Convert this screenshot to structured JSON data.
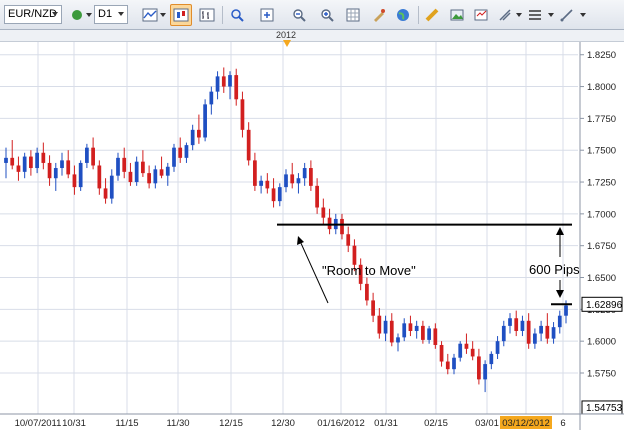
{
  "toolbar": {
    "symbol": "EUR/NZD",
    "timeframe": "D1",
    "icons": [
      "circle-indicator-icon",
      "line-chart-icon",
      "candlestick-chart-icon",
      "bar-chart-icon",
      "crosshair-icon",
      "zoom-in-icon",
      "zoom-out-icon",
      "zoom-fit-icon",
      "grid-icon",
      "color-scheme-icon",
      "globe-icon",
      "ruler-icon",
      "screenshot-icon",
      "print-icon",
      "indicators-icon",
      "settings-icon",
      "drawing-tool-icon"
    ]
  },
  "timebar": {
    "year_label": "2012"
  },
  "colors": {
    "bull": "#1f4fc2",
    "bear": "#d21f1f",
    "grid": "#d8dde8",
    "axis_bg": "#ffffff",
    "current_bg": "#ffffff",
    "date_highlight": "#f5a81e",
    "low_bg": "#ffffff"
  },
  "annotations": {
    "room_to_move": "\"Room to Move\"",
    "pips": "600 Pips"
  },
  "chart_data": {
    "type": "candlestick",
    "instrument": "EUR/NZD",
    "timeframe": "D1",
    "y_axis": {
      "ticks": [
        "1.8250",
        "1.8000",
        "1.7750",
        "1.7500",
        "1.7250",
        "1.7000",
        "1.6750",
        "1.6500",
        "1.6250",
        "1.6000",
        "1.5750"
      ],
      "range": [
        1.5475,
        1.835
      ],
      "current_price": "1.62896",
      "low_price": "1.54753"
    },
    "x_axis": {
      "labels": [
        "10/07/2011",
        "10/31",
        "11/15",
        "11/30",
        "12/15",
        "12/30",
        "01/16/2012",
        "01/31",
        "02/15",
        "03/01",
        "03/12/2012",
        "6"
      ],
      "highlighted_label": "03/12/2012"
    },
    "resistance_level": 1.6915,
    "current_level": 1.62896,
    "grid": true,
    "candles": [
      [
        1.74,
        1.752,
        1.728,
        1.744
      ],
      [
        1.744,
        1.758,
        1.735,
        1.738
      ],
      [
        1.738,
        1.745,
        1.726,
        1.733
      ],
      [
        1.733,
        1.748,
        1.728,
        1.745
      ],
      [
        1.745,
        1.75,
        1.73,
        1.736
      ],
      [
        1.736,
        1.752,
        1.732,
        1.748
      ],
      [
        1.748,
        1.756,
        1.735,
        1.74
      ],
      [
        1.74,
        1.746,
        1.722,
        1.728
      ],
      [
        1.728,
        1.74,
        1.718,
        1.736
      ],
      [
        1.736,
        1.748,
        1.73,
        1.742
      ],
      [
        1.742,
        1.75,
        1.728,
        1.731
      ],
      [
        1.731,
        1.738,
        1.715,
        1.721
      ],
      [
        1.721,
        1.742,
        1.718,
        1.74
      ],
      [
        1.74,
        1.755,
        1.736,
        1.752
      ],
      [
        1.752,
        1.76,
        1.735,
        1.738
      ],
      [
        1.738,
        1.742,
        1.715,
        1.72
      ],
      [
        1.72,
        1.728,
        1.708,
        1.712
      ],
      [
        1.712,
        1.735,
        1.708,
        1.73
      ],
      [
        1.73,
        1.748,
        1.726,
        1.744
      ],
      [
        1.744,
        1.752,
        1.728,
        1.733
      ],
      [
        1.733,
        1.74,
        1.722,
        1.725
      ],
      [
        1.725,
        1.745,
        1.722,
        1.741
      ],
      [
        1.741,
        1.75,
        1.729,
        1.732
      ],
      [
        1.732,
        1.738,
        1.72,
        1.724
      ],
      [
        1.724,
        1.738,
        1.72,
        1.735
      ],
      [
        1.735,
        1.745,
        1.728,
        1.73
      ],
      [
        1.73,
        1.74,
        1.722,
        1.737
      ],
      [
        1.737,
        1.755,
        1.733,
        1.752
      ],
      [
        1.752,
        1.76,
        1.74,
        1.744
      ],
      [
        1.744,
        1.756,
        1.74,
        1.754
      ],
      [
        1.754,
        1.77,
        1.75,
        1.766
      ],
      [
        1.766,
        1.778,
        1.755,
        1.76
      ],
      [
        1.76,
        1.79,
        1.757,
        1.786
      ],
      [
        1.786,
        1.8,
        1.778,
        1.796
      ],
      [
        1.796,
        1.812,
        1.79,
        1.808
      ],
      [
        1.808,
        1.815,
        1.795,
        1.8
      ],
      [
        1.8,
        1.812,
        1.79,
        1.809
      ],
      [
        1.809,
        1.814,
        1.785,
        1.79
      ],
      [
        1.79,
        1.796,
        1.76,
        1.766
      ],
      [
        1.766,
        1.772,
        1.738,
        1.742
      ],
      [
        1.742,
        1.748,
        1.718,
        1.722
      ],
      [
        1.722,
        1.73,
        1.716,
        1.726
      ],
      [
        1.726,
        1.732,
        1.716,
        1.72
      ],
      [
        1.72,
        1.728,
        1.705,
        1.71
      ],
      [
        1.71,
        1.724,
        1.706,
        1.721
      ],
      [
        1.721,
        1.735,
        1.717,
        1.731
      ],
      [
        1.731,
        1.74,
        1.72,
        1.724
      ],
      [
        1.724,
        1.732,
        1.716,
        1.728
      ],
      [
        1.728,
        1.74,
        1.722,
        1.736
      ],
      [
        1.736,
        1.742,
        1.718,
        1.722
      ],
      [
        1.722,
        1.728,
        1.7,
        1.705
      ],
      [
        1.705,
        1.712,
        1.692,
        1.697
      ],
      [
        1.697,
        1.704,
        1.684,
        1.688
      ],
      [
        1.688,
        1.7,
        1.684,
        1.696
      ],
      [
        1.696,
        1.7,
        1.68,
        1.684
      ],
      [
        1.684,
        1.69,
        1.67,
        1.675
      ],
      [
        1.675,
        1.68,
        1.655,
        1.66
      ],
      [
        1.66,
        1.665,
        1.64,
        1.645
      ],
      [
        1.645,
        1.65,
        1.628,
        1.632
      ],
      [
        1.632,
        1.638,
        1.615,
        1.62
      ],
      [
        1.62,
        1.626,
        1.602,
        1.606
      ],
      [
        1.606,
        1.62,
        1.6,
        1.616
      ],
      [
        1.616,
        1.622,
        1.596,
        1.599
      ],
      [
        1.599,
        1.606,
        1.592,
        1.603
      ],
      [
        1.603,
        1.618,
        1.6,
        1.614
      ],
      [
        1.614,
        1.62,
        1.604,
        1.608
      ],
      [
        1.608,
        1.616,
        1.602,
        1.612
      ],
      [
        1.612,
        1.616,
        1.598,
        1.601
      ],
      [
        1.601,
        1.612,
        1.598,
        1.61
      ],
      [
        1.61,
        1.614,
        1.594,
        1.597
      ],
      [
        1.597,
        1.6,
        1.58,
        1.584
      ],
      [
        1.584,
        1.59,
        1.574,
        1.578
      ],
      [
        1.578,
        1.59,
        1.574,
        1.587
      ],
      [
        1.587,
        1.6,
        1.584,
        1.598
      ],
      [
        1.598,
        1.606,
        1.59,
        1.594
      ],
      [
        1.594,
        1.6,
        1.585,
        1.588
      ],
      [
        1.588,
        1.594,
        1.566,
        1.57
      ],
      [
        1.57,
        1.585,
        1.56,
        1.582
      ],
      [
        1.582,
        1.592,
        1.578,
        1.59
      ],
      [
        1.59,
        1.604,
        1.586,
        1.6
      ],
      [
        1.6,
        1.616,
        1.596,
        1.612
      ],
      [
        1.612,
        1.622,
        1.606,
        1.618
      ],
      [
        1.618,
        1.624,
        1.604,
        1.608
      ],
      [
        1.608,
        1.62,
        1.604,
        1.616
      ],
      [
        1.616,
        1.622,
        1.594,
        1.598
      ],
      [
        1.598,
        1.61,
        1.594,
        1.606
      ],
      [
        1.606,
        1.616,
        1.6,
        1.612
      ],
      [
        1.612,
        1.622,
        1.598,
        1.602
      ],
      [
        1.602,
        1.615,
        1.598,
        1.611
      ],
      [
        1.611,
        1.624,
        1.606,
        1.62
      ],
      [
        1.62,
        1.632,
        1.614,
        1.628
      ]
    ]
  }
}
